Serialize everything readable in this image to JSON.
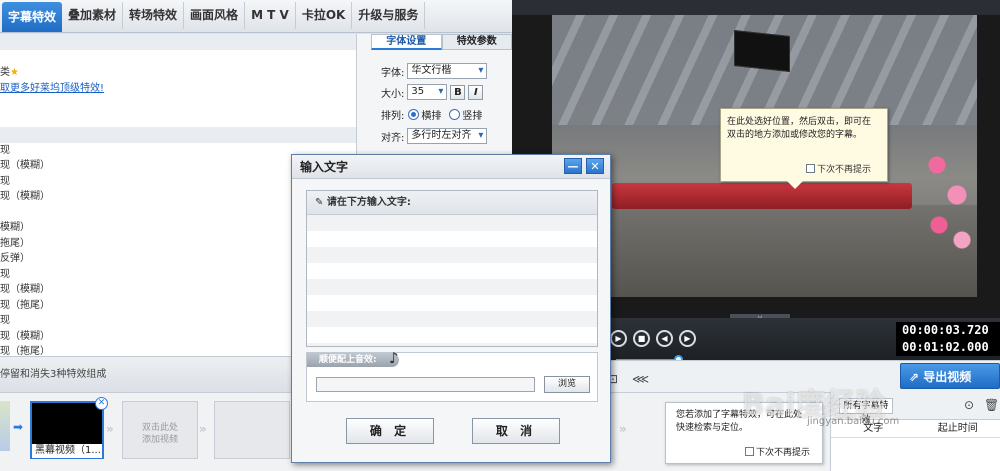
{
  "tabs": [
    {
      "label": "字幕特效",
      "active": true
    },
    {
      "label": "叠加素材",
      "active": false
    },
    {
      "label": "转场特效",
      "active": false
    },
    {
      "label": "画面风格",
      "active": false
    },
    {
      "label": "M T V",
      "active": false
    },
    {
      "label": "卡拉OK",
      "active": false
    },
    {
      "label": "升级与服务",
      "active": false
    }
  ],
  "effect_list": {
    "rows": [
      {
        "text": "",
        "style": "band"
      },
      {
        "text": "",
        "style": "plain"
      },
      {
        "text": "类",
        "style": "star"
      },
      {
        "text": "取更多好莱坞顶级特效!",
        "style": "link"
      },
      {
        "text": "",
        "style": "plain"
      },
      {
        "text": "",
        "style": "plain"
      },
      {
        "text": "",
        "style": "band"
      },
      {
        "text": "现",
        "style": "plain"
      },
      {
        "text": "现（模糊）",
        "style": "plain"
      },
      {
        "text": "现",
        "style": "plain"
      },
      {
        "text": "现（模糊）",
        "style": "plain"
      },
      {
        "text": "",
        "style": "plain"
      },
      {
        "text": "模糊）",
        "style": "plain"
      },
      {
        "text": "拖尾）",
        "style": "plain"
      },
      {
        "text": "反弹）",
        "style": "plain"
      },
      {
        "text": "现",
        "style": "plain"
      },
      {
        "text": "现（模糊）",
        "style": "plain"
      },
      {
        "text": "现（拖尾）",
        "style": "plain"
      },
      {
        "text": "现",
        "style": "plain"
      },
      {
        "text": "现（模糊）",
        "style": "plain"
      },
      {
        "text": "现（拖尾）",
        "style": "plain"
      }
    ],
    "status": "停留和消失3种特效组成"
  },
  "properties": {
    "tabs": [
      "字体设置",
      "特效参数"
    ],
    "font_label": "字体:",
    "font_value": "华文行楷",
    "size_label": "大小:",
    "size_value": "35",
    "bold_label": "B",
    "italic_label": "I",
    "arrange_label": "排列:",
    "horizontal_label": "横排",
    "vertical_label": "竖排",
    "align_label": "对齐:",
    "align_value": "多行时左对齐"
  },
  "preview": {
    "tooltip_line1": "在此处选好位置，然后双击，即可在",
    "tooltip_line2": "双击的地方添加或修改您的字幕。",
    "tooltip_dont_show": "下次不再提示",
    "collapse_label": "v"
  },
  "player": {
    "current_time": "00:00:03.720",
    "total_time": "00:01:02.000",
    "progress_fraction": 0.37
  },
  "export_label": "导出视频",
  "timeline": {
    "video_caption": "黑幕视频（1...",
    "add_video_line1": "双击此处",
    "add_video_line2": "添加视频",
    "hint_line1": "您若添加了字幕特效，可在此处",
    "hint_line2": "快速检索与定位。",
    "hint_dont_show": "下次不再提示"
  },
  "subtitle_panel": {
    "tab_label": "所有字幕特效",
    "col_text": "文字",
    "col_time": "起止时间"
  },
  "dialog": {
    "title": "输入文字",
    "minimize": "—",
    "close": "✕",
    "text_prompt": "请在下方输入文字:",
    "sound_label": "顺便配上音效:",
    "browse": "浏览",
    "ok": "确 定",
    "cancel": "取 消"
  },
  "watermark": {
    "text": "Bai度经验",
    "url": "jingyan.baidu.com"
  }
}
